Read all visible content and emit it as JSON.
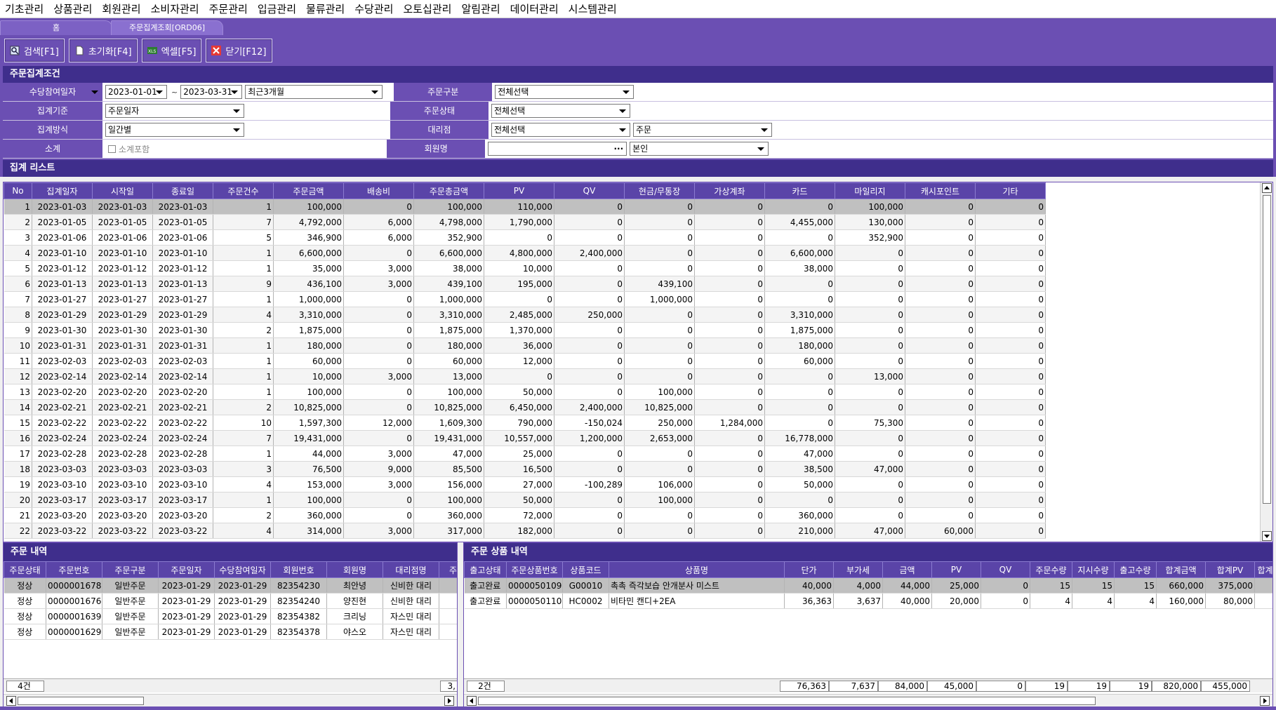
{
  "menu": [
    "기초관리",
    "상품관리",
    "회원관리",
    "소비자관리",
    "주문관리",
    "입금관리",
    "물류관리",
    "수당관리",
    "오토십관리",
    "알림관리",
    "데이터관리",
    "시스템관리"
  ],
  "tabs": {
    "home": "홈",
    "current": "주문집계조회[ORD06]"
  },
  "toolbar": {
    "search": "검색[F1]",
    "reset": "초기화[F4]",
    "excel": "엑셀[F5]",
    "close": "닫기[F12]"
  },
  "conditions": {
    "title": "주문집계조건",
    "allowance_date_label": "수당참여일자",
    "date_from": "2023-01-01",
    "date_to": "2023-03-31",
    "period": "최근3개월",
    "basis_label": "집계기준",
    "basis_value": "주문일자",
    "method_label": "집계방식",
    "method_value": "일간별",
    "subtotal_label": "소계",
    "subtotal_check": "소계포함",
    "order_type_label": "주문구분",
    "order_type_value": "전체선택",
    "order_status_label": "주문상태",
    "order_status_value": "전체선택",
    "agency_label": "대리점",
    "agency_value": "전체선택",
    "agency_sub_value": "주문",
    "member_label": "회원명",
    "member_value": "",
    "member_sub_value": "본인"
  },
  "summary": {
    "title": "집계 리스트",
    "columns": [
      "No",
      "집계일자",
      "시작일",
      "종료일",
      "주문건수",
      "주문금액",
      "배송비",
      "주문총금액",
      "PV",
      "QV",
      "현금/무통장",
      "가상계좌",
      "카드",
      "마일리지",
      "캐시포인트",
      "기타"
    ],
    "rows": [
      [
        "1",
        "2023-01-03",
        "2023-01-03",
        "2023-01-03",
        "1",
        "100,000",
        "0",
        "100,000",
        "110,000",
        "0",
        "0",
        "0",
        "0",
        "100,000",
        "0",
        "0"
      ],
      [
        "2",
        "2023-01-05",
        "2023-01-05",
        "2023-01-05",
        "7",
        "4,792,000",
        "6,000",
        "4,798,000",
        "1,790,000",
        "0",
        "0",
        "0",
        "4,455,000",
        "130,000",
        "0",
        "0"
      ],
      [
        "3",
        "2023-01-06",
        "2023-01-06",
        "2023-01-06",
        "5",
        "346,900",
        "6,000",
        "352,900",
        "0",
        "0",
        "0",
        "0",
        "0",
        "352,900",
        "0",
        "0"
      ],
      [
        "4",
        "2023-01-10",
        "2023-01-10",
        "2023-01-10",
        "1",
        "6,600,000",
        "0",
        "6,600,000",
        "4,800,000",
        "2,400,000",
        "0",
        "0",
        "6,600,000",
        "0",
        "0",
        "0"
      ],
      [
        "5",
        "2023-01-12",
        "2023-01-12",
        "2023-01-12",
        "1",
        "35,000",
        "3,000",
        "38,000",
        "10,000",
        "0",
        "0",
        "0",
        "38,000",
        "0",
        "0",
        "0"
      ],
      [
        "6",
        "2023-01-13",
        "2023-01-13",
        "2023-01-13",
        "9",
        "436,100",
        "3,000",
        "439,100",
        "195,000",
        "0",
        "439,100",
        "0",
        "0",
        "0",
        "0",
        "0"
      ],
      [
        "7",
        "2023-01-27",
        "2023-01-27",
        "2023-01-27",
        "1",
        "1,000,000",
        "0",
        "1,000,000",
        "0",
        "0",
        "1,000,000",
        "0",
        "0",
        "0",
        "0",
        "0"
      ],
      [
        "8",
        "2023-01-29",
        "2023-01-29",
        "2023-01-29",
        "4",
        "3,310,000",
        "0",
        "3,310,000",
        "2,485,000",
        "250,000",
        "0",
        "0",
        "3,310,000",
        "0",
        "0",
        "0"
      ],
      [
        "9",
        "2023-01-30",
        "2023-01-30",
        "2023-01-30",
        "2",
        "1,875,000",
        "0",
        "1,875,000",
        "1,370,000",
        "0",
        "0",
        "0",
        "1,875,000",
        "0",
        "0",
        "0"
      ],
      [
        "10",
        "2023-01-31",
        "2023-01-31",
        "2023-01-31",
        "1",
        "180,000",
        "0",
        "180,000",
        "36,000",
        "0",
        "0",
        "0",
        "180,000",
        "0",
        "0",
        "0"
      ],
      [
        "11",
        "2023-02-03",
        "2023-02-03",
        "2023-02-03",
        "1",
        "60,000",
        "0",
        "60,000",
        "12,000",
        "0",
        "0",
        "0",
        "60,000",
        "0",
        "0",
        "0"
      ],
      [
        "12",
        "2023-02-14",
        "2023-02-14",
        "2023-02-14",
        "1",
        "10,000",
        "3,000",
        "13,000",
        "0",
        "0",
        "0",
        "0",
        "0",
        "13,000",
        "0",
        "0"
      ],
      [
        "13",
        "2023-02-20",
        "2023-02-20",
        "2023-02-20",
        "1",
        "100,000",
        "0",
        "100,000",
        "50,000",
        "0",
        "100,000",
        "0",
        "0",
        "0",
        "0",
        "0"
      ],
      [
        "14",
        "2023-02-21",
        "2023-02-21",
        "2023-02-21",
        "2",
        "10,825,000",
        "0",
        "10,825,000",
        "6,450,000",
        "2,400,000",
        "10,825,000",
        "0",
        "0",
        "0",
        "0",
        "0"
      ],
      [
        "15",
        "2023-02-22",
        "2023-02-22",
        "2023-02-22",
        "10",
        "1,597,300",
        "12,000",
        "1,609,300",
        "790,000",
        "-150,024",
        "250,000",
        "1,284,000",
        "0",
        "75,300",
        "0",
        "0"
      ],
      [
        "16",
        "2023-02-24",
        "2023-02-24",
        "2023-02-24",
        "7",
        "19,431,000",
        "0",
        "19,431,000",
        "10,557,000",
        "1,200,000",
        "2,653,000",
        "0",
        "16,778,000",
        "0",
        "0",
        "0"
      ],
      [
        "17",
        "2023-02-28",
        "2023-02-28",
        "2023-02-28",
        "1",
        "44,000",
        "3,000",
        "47,000",
        "25,000",
        "0",
        "0",
        "0",
        "47,000",
        "0",
        "0",
        "0"
      ],
      [
        "18",
        "2023-03-03",
        "2023-03-03",
        "2023-03-03",
        "3",
        "76,500",
        "9,000",
        "85,500",
        "16,500",
        "0",
        "0",
        "0",
        "38,500",
        "47,000",
        "0",
        "0"
      ],
      [
        "19",
        "2023-03-10",
        "2023-03-10",
        "2023-03-10",
        "4",
        "153,000",
        "3,000",
        "156,000",
        "27,000",
        "-100,289",
        "106,000",
        "0",
        "50,000",
        "0",
        "0",
        "0"
      ],
      [
        "20",
        "2023-03-17",
        "2023-03-17",
        "2023-03-17",
        "1",
        "100,000",
        "0",
        "100,000",
        "50,000",
        "0",
        "100,000",
        "0",
        "0",
        "0",
        "0",
        "0"
      ],
      [
        "21",
        "2023-03-20",
        "2023-03-20",
        "2023-03-20",
        "2",
        "360,000",
        "0",
        "360,000",
        "72,000",
        "0",
        "0",
        "0",
        "360,000",
        "0",
        "0",
        "0"
      ],
      [
        "22",
        "2023-03-22",
        "2023-03-22",
        "2023-03-22",
        "4",
        "314,000",
        "3,000",
        "317,000",
        "182,000",
        "0",
        "0",
        "0",
        "210,000",
        "47,000",
        "60,000",
        "0"
      ]
    ]
  },
  "orders": {
    "title": "주문 내역",
    "columns": [
      "주문상태",
      "주문번호",
      "주문구분",
      "주문일자",
      "수당참여일자",
      "회원번호",
      "회원명",
      "대리점명",
      "주"
    ],
    "rows": [
      [
        "정상",
        "0000001678",
        "일반주문",
        "2023-01-29",
        "2023-01-29",
        "82354230",
        "최안녕",
        "신비한 대리",
        ""
      ],
      [
        "정상",
        "0000001676",
        "일반주문",
        "2023-01-29",
        "2023-01-29",
        "82354240",
        "양진현",
        "신비한 대리",
        "1,"
      ],
      [
        "정상",
        "0000001639",
        "일반주문",
        "2023-01-29",
        "2023-01-29",
        "82354382",
        "크리닝",
        "자스민 대리",
        "1,"
      ],
      [
        "정상",
        "0000001629",
        "일반주문",
        "2023-01-29",
        "2023-01-29",
        "82354378",
        "야스오",
        "자스민 대리",
        ""
      ]
    ],
    "footer_count": "4건",
    "footer_value": "3,"
  },
  "products": {
    "title": "주문 상품 내역",
    "columns": [
      "출고상태",
      "주문상품번호",
      "상품코드",
      "상품명",
      "단가",
      "부가세",
      "금액",
      "PV",
      "QV",
      "주문수량",
      "지시수량",
      "출고수량",
      "합계금액",
      "합계PV",
      "합계"
    ],
    "rows": [
      [
        "출고완료",
        "0000050109",
        "G00010",
        "촉촉 즉각보습 안개분사 미스트",
        "40,000",
        "4,000",
        "44,000",
        "25,000",
        "0",
        "15",
        "15",
        "15",
        "660,000",
        "375,000",
        ""
      ],
      [
        "출고완료",
        "0000050110",
        "HC0002",
        "비타민 캔디+2EA",
        "36,363",
        "3,637",
        "40,000",
        "20,000",
        "0",
        "4",
        "4",
        "4",
        "160,000",
        "80,000",
        ""
      ]
    ],
    "footer": [
      "2건",
      "76,363",
      "7,637",
      "84,000",
      "45,000",
      "0",
      "19",
      "19",
      "19",
      "820,000",
      "455,000"
    ]
  }
}
